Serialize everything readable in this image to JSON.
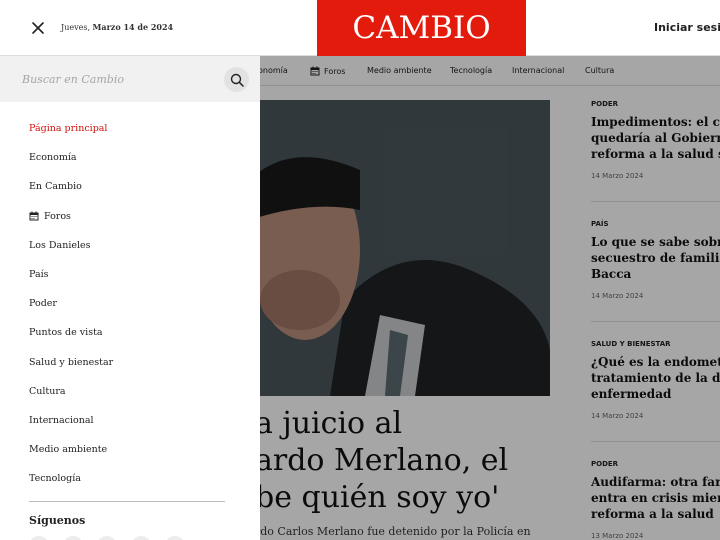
{
  "header": {
    "date_day": "Jueves, ",
    "date_value": "Marzo 14 de 2024",
    "logo": "CAMBIO",
    "login": "Iniciar sesión"
  },
  "nav": {
    "items": [
      "Economía",
      "Foros",
      "Medio ambiente",
      "Tecnología",
      "Internacional",
      "Cultura"
    ],
    "economia_visible": "onomía"
  },
  "search": {
    "placeholder": "Buscar en Cambio"
  },
  "drawer": {
    "items": [
      "Página principal",
      "Economía",
      "En Cambio",
      "Foros",
      "Los Danieles",
      "País",
      "Poder",
      "Puntos de vista",
      "Salud y bienestar",
      "Cultura",
      "Internacional",
      "Medio ambiente",
      "Tecnología"
    ],
    "follow_label": "Síguenos"
  },
  "hero": {
    "title_line1": "a juicio al",
    "title_line2": "ardo Merlano, el",
    "title_line3": "be quién soy yo'",
    "subtitle": "rdo Carlos Merlano fue detenido por la Policía en"
  },
  "sidebar_news": [
    {
      "category": "PODER",
      "lines": [
        "Impedimentos: el cam",
        "quedaría al Gobierno p",
        "reforma a la salud sob"
      ],
      "date": "14 Marzo 2024"
    },
    {
      "category": "PAÍS",
      "lines": [
        "Lo que se sabe sobre el",
        "secuestro de familiare",
        "Bacca"
      ],
      "date": "14 Marzo 2024"
    },
    {
      "category": "SALUD Y BIENESTAR",
      "lines": [
        "¿Qué es la endometrio",
        "tratamiento de la debi",
        "enfermedad"
      ],
      "date": "14 Marzo 2024"
    },
    {
      "category": "PODER",
      "lines": [
        "Audifarma: otra farma",
        "entra en crisis mientra",
        "reforma a la salud"
      ],
      "date": "13 Marzo 2024"
    }
  ],
  "colors": {
    "brand_red": "#e31b0c",
    "active_menu": "#d0100c",
    "overlay": "rgba(0,0,0,0.35)"
  }
}
